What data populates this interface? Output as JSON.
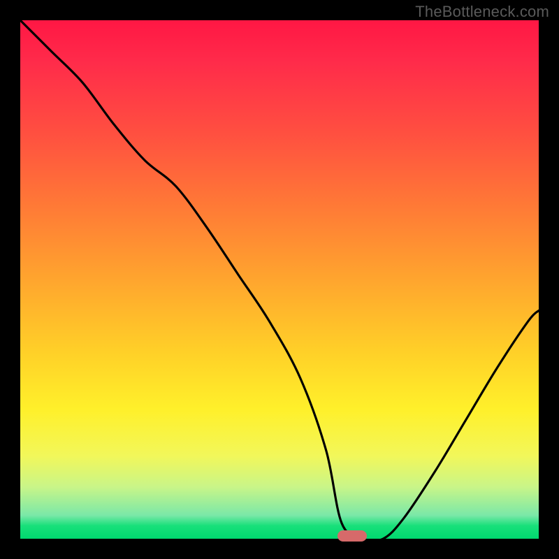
{
  "attribution": "TheBottleneck.com",
  "marker": {
    "x_pct": 64,
    "y_pct": 0.5
  },
  "chart_data": {
    "type": "line",
    "title": "",
    "xlabel": "",
    "ylabel": "",
    "xlim": [
      0,
      100
    ],
    "ylim": [
      0,
      100
    ],
    "series": [
      {
        "name": "bottleneck-curve",
        "x": [
          0,
          6,
          12,
          18,
          24,
          30,
          36,
          42,
          48,
          54,
          59,
          62,
          66,
          70,
          74,
          80,
          86,
          92,
          98,
          100
        ],
        "y": [
          100,
          94,
          88,
          80,
          73,
          68,
          60,
          51,
          42,
          31,
          17,
          3,
          0,
          0,
          4,
          13,
          23,
          33,
          42,
          44
        ]
      }
    ],
    "annotations": [
      {
        "type": "marker",
        "shape": "pill",
        "color": "#d66a6a",
        "x": 64,
        "y": 0.5
      }
    ],
    "background_gradient": {
      "stops": [
        {
          "pct": 0,
          "color": "#ff1744"
        },
        {
          "pct": 50,
          "color": "#ffa52e"
        },
        {
          "pct": 75,
          "color": "#fff02a"
        },
        {
          "pct": 100,
          "color": "#00d86f"
        }
      ]
    }
  }
}
